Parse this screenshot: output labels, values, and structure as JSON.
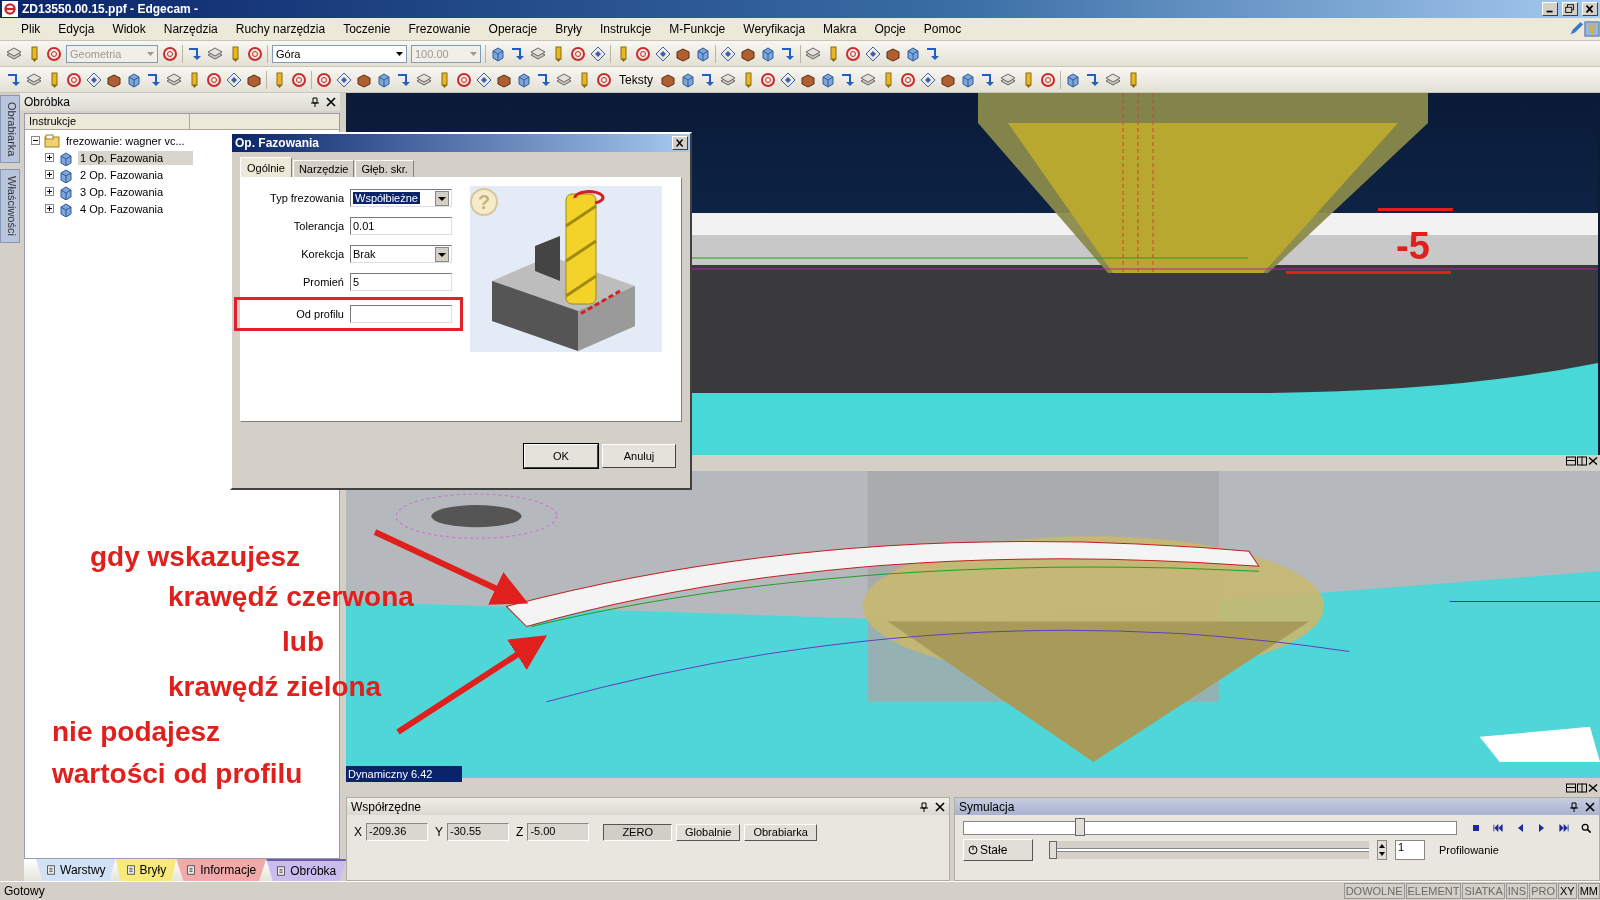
{
  "window": {
    "title": "ZD13550.00.15.ppf - Edgecam -"
  },
  "menu": [
    "Plik",
    "Edycja",
    "Widok",
    "Narzędzia",
    "Ruchy narzędzia",
    "Toczenie",
    "Frezowanie",
    "Operacje",
    "Bryły",
    "Instrukcje",
    "M-Funkcje",
    "Weryfikacja",
    "Makra",
    "Opcje",
    "Pomoc"
  ],
  "toolbar": {
    "layer_combo": {
      "value": "Geometria",
      "disabled": true
    },
    "view_combo": {
      "value": "Góra",
      "disabled": false
    },
    "scale_combo": {
      "value": "100.00",
      "disabled": true
    },
    "text_button": "Teksty"
  },
  "side_tabs": [
    "Obrabiarka",
    "Właściwości"
  ],
  "panel": {
    "title": "Obróbka",
    "column": "Instrukcje",
    "tree": {
      "label": "frezowanie: wagner vc...",
      "expanded": true,
      "children": [
        {
          "label": "1 Op. Fazowania",
          "selected": true,
          "expanded": false
        },
        {
          "label": "2 Op. Fazowania",
          "selected": false,
          "expanded": false
        },
        {
          "label": "3 Op. Fazowania",
          "selected": false,
          "expanded": false
        },
        {
          "label": "4 Op. Fazowania",
          "selected": false,
          "expanded": false
        }
      ]
    }
  },
  "panel_tabs": [
    {
      "label": "Warstwy",
      "color": "#d2e2f6",
      "selected": false
    },
    {
      "label": "Bryły",
      "color": "#f7ea7a",
      "selected": false
    },
    {
      "label": "Informacje",
      "color": "#f2a9a9",
      "selected": false
    },
    {
      "label": "Obróbka",
      "color": "#cbbcf0",
      "selected": true
    }
  ],
  "dialog": {
    "title": "Op. Fazowania",
    "tabs": [
      {
        "label": "Ogólnie",
        "selected": true
      },
      {
        "label": "Narzędzie",
        "selected": false
      },
      {
        "label": "Głęb. skr.",
        "selected": false
      }
    ],
    "fields": [
      {
        "label": "Typ frezowania",
        "kind": "combo",
        "value": "Współbieżne",
        "highlighted": true
      },
      {
        "label": "Tolerancja",
        "kind": "text",
        "value": "0.01"
      },
      {
        "label": "Korekcja",
        "kind": "combo",
        "value": "Brak"
      },
      {
        "label": "Promień",
        "kind": "text",
        "value": "5"
      },
      {
        "label": "Od profilu",
        "kind": "text",
        "marked": true
      }
    ],
    "help_icon": "?",
    "buttons": [
      {
        "label": "OK",
        "default": true
      },
      {
        "label": "Anuluj",
        "default": false
      }
    ]
  },
  "viewport_top": {
    "dimension": "-5"
  },
  "viewport_bottom": {
    "label": "Dynamiczny 6.42"
  },
  "annotations": [
    "gdy wskazujesz",
    "krawędź czerwona",
    "lub",
    "krawędź zielona",
    "nie podajesz",
    "wartości od profilu"
  ],
  "coordinates": {
    "title": "Współrzędne",
    "fields": [
      {
        "axis": "X",
        "value": "-209.36"
      },
      {
        "axis": "Y",
        "value": "-30.55"
      },
      {
        "axis": "Z",
        "value": "-5.00"
      }
    ],
    "buttons": [
      {
        "label": "ZERO",
        "pressed": true
      },
      {
        "label": "Globalnie",
        "pressed": false
      },
      {
        "label": "Obrabiarka",
        "pressed": false
      }
    ]
  },
  "simulation": {
    "title": "Symulacja",
    "position": {
      "level": 0.23
    },
    "speed_button": "Stałe",
    "speed": {
      "level": 0
    },
    "step": "1",
    "mode": "Profilowanie"
  },
  "status_bar": {
    "text": "Gotowy",
    "indicators": [
      {
        "label": "DOWOLNE",
        "on": false
      },
      {
        "label": "ELEMENT",
        "on": false
      },
      {
        "label": "SIATKA",
        "on": false
      },
      {
        "label": "INS",
        "on": false
      },
      {
        "label": "PRO",
        "on": false
      },
      {
        "label": "XY",
        "on": true
      },
      {
        "label": "MM",
        "on": true
      }
    ]
  }
}
